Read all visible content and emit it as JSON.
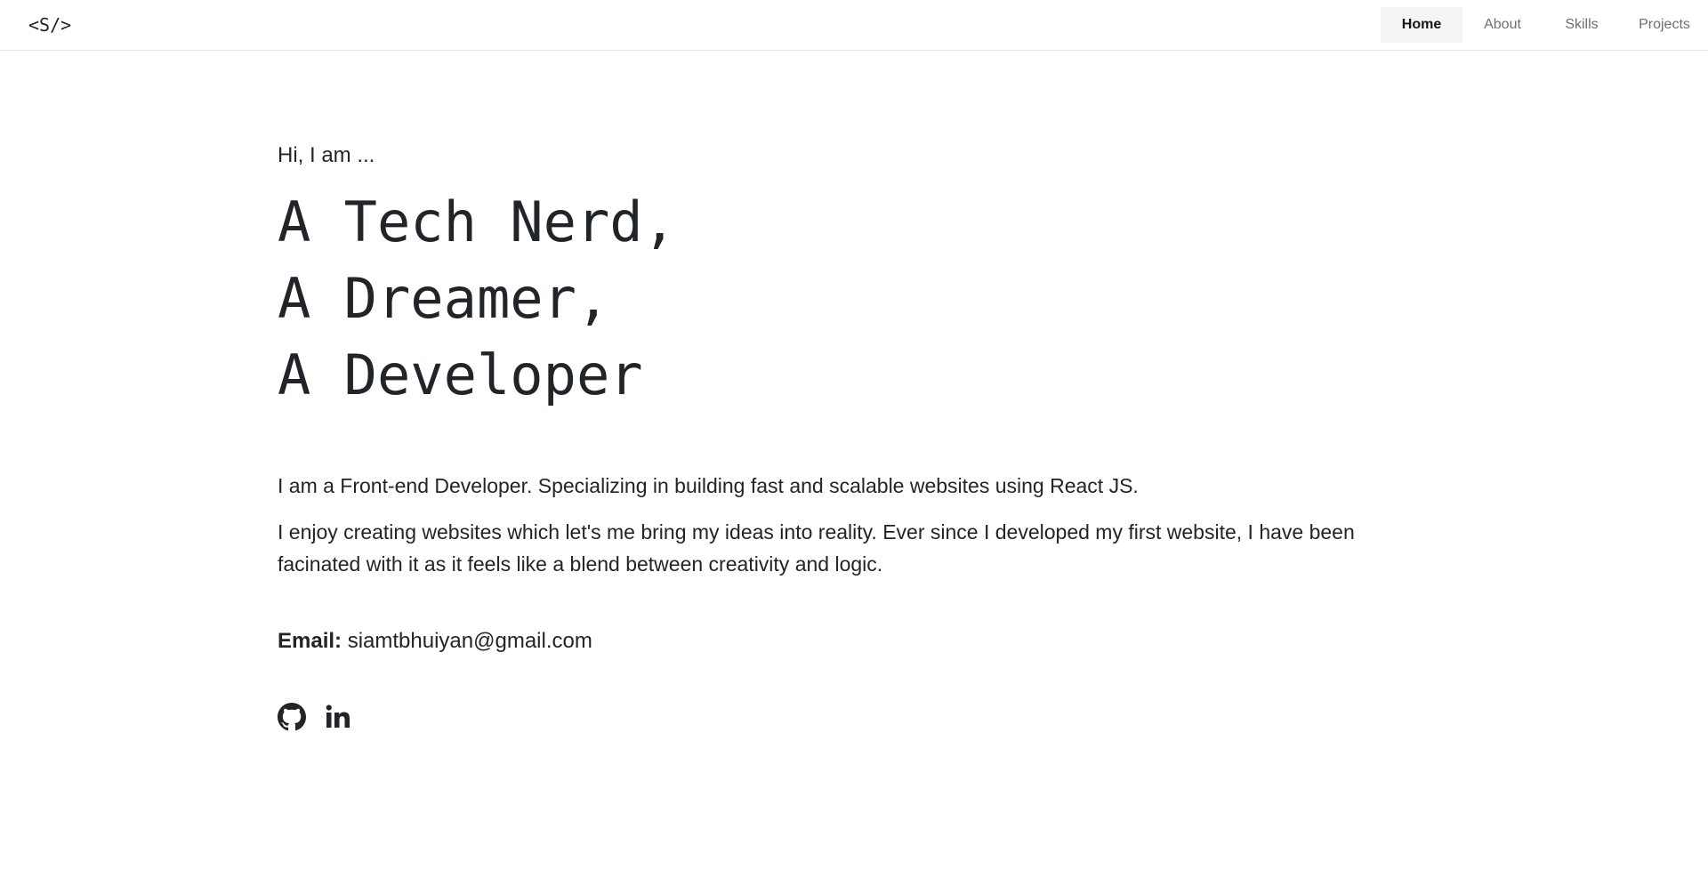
{
  "header": {
    "logo": "<S/>",
    "nav": {
      "home": "Home",
      "about": "About",
      "skills": "Skills",
      "projects": "Projects"
    },
    "active": "Home"
  },
  "hero": {
    "greeting": "Hi, I am ...",
    "headline": [
      "A Tech Nerd,",
      "A Dreamer,",
      "A Developer"
    ]
  },
  "bio": {
    "paragraph_1": "I am a Front-end Developer. Specializing in building fast and scalable websites using React JS.",
    "paragraph_2": "I enjoy creating websites which let's me bring my ideas into reality. Ever since I developed my first website, I have been facinated with it as it feels like a blend between creativity and logic."
  },
  "contact": {
    "email_label": "Email:",
    "email_value": "siamtbhuiyan@gmail.com"
  },
  "socials": {
    "github_icon": "github-icon",
    "linkedin_icon": "linkedin-icon"
  },
  "colors": {
    "text": "#212529",
    "nav_inactive": "#6f6f6f",
    "nav_active_bg": "#f4f4f4",
    "border": "#e6e6e6"
  }
}
